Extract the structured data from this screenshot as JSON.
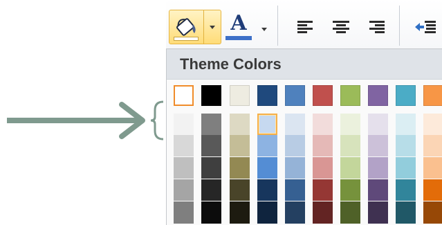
{
  "toolbar": {
    "fill_color_button": {
      "icon": "paint-bucket-icon",
      "current_color": "#ffffff"
    },
    "font_color_button": {
      "icon": "font-color-icon",
      "letter": "A",
      "current_color": "#3d70c8"
    },
    "buttons": [
      {
        "name": "align-left-button",
        "icon": "align-left-icon"
      },
      {
        "name": "align-center-button",
        "icon": "align-center-icon"
      },
      {
        "name": "align-right-button",
        "icon": "align-right-icon"
      },
      {
        "name": "decrease-indent-button",
        "icon": "decrease-indent-icon"
      }
    ]
  },
  "palette": {
    "title": "Theme Colors",
    "base_colors": [
      "#ffffff",
      "#000000",
      "#eeece1",
      "#1f497d",
      "#4f81bd",
      "#c0504d",
      "#9bbb59",
      "#8064a2",
      "#4bacc6",
      "#f79646"
    ],
    "shade_rows": [
      [
        "#f2f2f2",
        "#7f7f7f",
        "#ddd9c3",
        "#c6d9f0",
        "#dbe5f1",
        "#f2dcdb",
        "#ebf1dd",
        "#e5e0ec",
        "#dbeef3",
        "#fdeada"
      ],
      [
        "#d8d8d8",
        "#595959",
        "#c4bd97",
        "#8db3e2",
        "#b8cce4",
        "#e5b9b7",
        "#d7e3bc",
        "#ccc1d9",
        "#b7dde8",
        "#fbd5b5"
      ],
      [
        "#bfbfbf",
        "#3f3f3f",
        "#938953",
        "#548dd4",
        "#95b3d7",
        "#d99694",
        "#c3d69b",
        "#b2a2c7",
        "#92cddc",
        "#fac08f"
      ],
      [
        "#a5a5a5",
        "#262626",
        "#494429",
        "#17365d",
        "#366092",
        "#953734",
        "#76923c",
        "#5f497a",
        "#31859b",
        "#e36c09"
      ],
      [
        "#7f7f7f",
        "#0c0c0c",
        "#1d1b10",
        "#0f243e",
        "#244061",
        "#632423",
        "#4f6128",
        "#3f3151",
        "#205867",
        "#974806"
      ]
    ],
    "selected_base_index": 0,
    "hovered_shade": {
      "row": 0,
      "col": 3
    }
  },
  "annotation": {
    "arrow_color": "#7f9a8e"
  }
}
